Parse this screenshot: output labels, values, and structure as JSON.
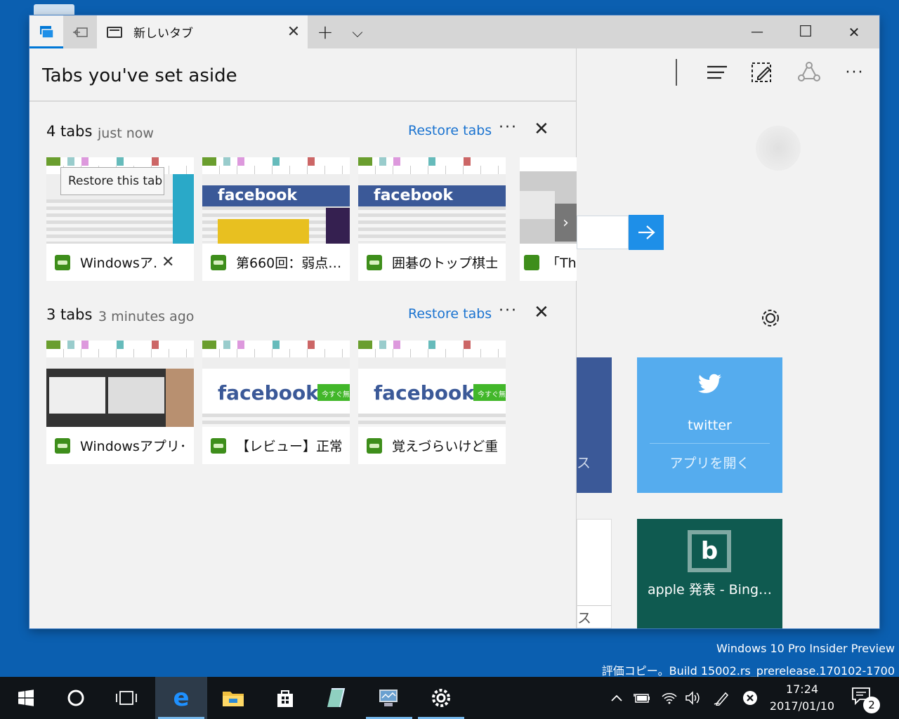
{
  "window": {
    "tab_title": "新しいタブ",
    "tab_close": "✕",
    "new_tab": "+",
    "tab_list": "⌵",
    "minimize": "—",
    "maximize": "☐",
    "close": "✕"
  },
  "panel": {
    "title": "Tabs you've set aside",
    "groups": [
      {
        "count": "4 tabs",
        "time": "just now",
        "restore": "Restore tabs",
        "more": "···",
        "close": "✕",
        "tooltip": "Restore this tab",
        "tabs": [
          {
            "title": "Windowsア…",
            "close": "✕"
          },
          {
            "title": "第660回：弱点…"
          },
          {
            "title": "囲碁のトップ棋士…"
          },
          {
            "title": "「Thu"
          }
        ]
      },
      {
        "count": "3 tabs",
        "time": "3 minutes ago",
        "restore": "Restore tabs",
        "more": "···",
        "close": "✕",
        "tabs": [
          {
            "title": "Windowsアプリ･…"
          },
          {
            "title": "【レビュー】正常に…"
          },
          {
            "title": "覚えづらいけど重…"
          }
        ]
      }
    ],
    "scroll_arrow": "›",
    "thumb_text": {
      "facebook": "facebook",
      "sign_up": "今すぐ無料"
    }
  },
  "browser": {
    "icons": [
      "hub-icon",
      "web-note-icon",
      "share-icon",
      "more-icon"
    ],
    "tiles": {
      "twitter_name": "twitter",
      "twitter_action": "アプリを開く",
      "facebook_partial": "ス",
      "white_partial": "ス",
      "bing_name": "apple 発表 - Bing…"
    }
  },
  "watermark": {
    "line1": "Windows 10 Pro Insider Preview",
    "line2": "評価コピー。Build 15002.rs_prerelease.170102-1700"
  },
  "taskbar": {
    "time": "17:24",
    "date": "2017/01/10",
    "notifications": "2"
  },
  "colors": {
    "desktop": "#0b5fb0",
    "accent": "#0078d7",
    "facebook": "#3b5998",
    "twitter": "#55acee",
    "bing_tile": "#0f5a50"
  }
}
